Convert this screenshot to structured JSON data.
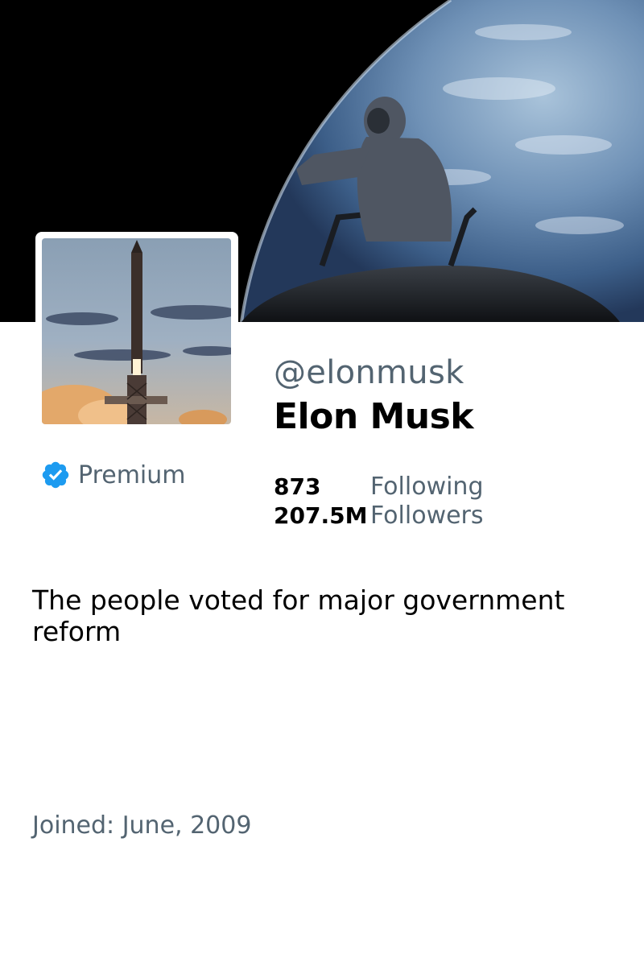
{
  "profile": {
    "handle": "@elonmusk",
    "display_name": "Elon Musk",
    "badge": {
      "label": "Premium",
      "icon": "verified-badge-icon",
      "color": "#1d9bf0"
    },
    "stats": [
      {
        "value": "873",
        "label": "Following"
      },
      {
        "value": "207.5M",
        "label": "Followers"
      }
    ],
    "bio": "The people voted for major government reform",
    "joined": "Joined: June, 2009"
  },
  "images": {
    "banner": "astronaut-over-earth-image",
    "avatar": "rocket-launch-image"
  },
  "colors": {
    "secondary_text": "#536471",
    "primary_text": "#000000",
    "background": "#ffffff"
  }
}
